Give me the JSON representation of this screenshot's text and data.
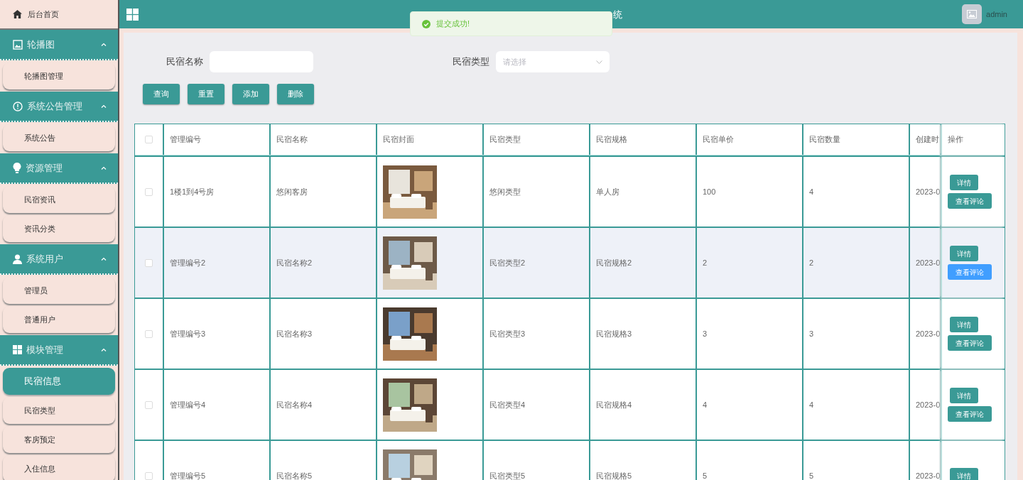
{
  "header": {
    "title": "统",
    "user": "admin"
  },
  "toast": {
    "message": "提交成功!"
  },
  "sidebar": {
    "home": "后台首页",
    "groups": [
      {
        "title": "轮播图",
        "expanded": true,
        "items": [
          {
            "label": "轮播图管理",
            "selected": false
          }
        ]
      },
      {
        "title": "系统公告管理",
        "expanded": true,
        "items": [
          {
            "label": "系统公告",
            "selected": false
          }
        ]
      },
      {
        "title": "资源管理",
        "expanded": true,
        "items": [
          {
            "label": "民宿资讯",
            "selected": false
          },
          {
            "label": "资讯分类",
            "selected": false
          }
        ]
      },
      {
        "title": "系统用户",
        "expanded": true,
        "items": [
          {
            "label": "管理员",
            "selected": false
          },
          {
            "label": "普通用户",
            "selected": false
          }
        ]
      },
      {
        "title": "模块管理",
        "expanded": true,
        "items": [
          {
            "label": "民宿信息",
            "selected": true
          },
          {
            "label": "民宿类型",
            "selected": false
          },
          {
            "label": "客房预定",
            "selected": false
          },
          {
            "label": "入住信息",
            "selected": false
          }
        ]
      }
    ]
  },
  "search": {
    "fields": [
      {
        "kind": "text",
        "label": "民宿名称"
      },
      {
        "kind": "select",
        "label": "民宿类型",
        "placeholder": "请选择"
      }
    ],
    "buttons": [
      "查询",
      "重置",
      "添加",
      "删除"
    ]
  },
  "table": {
    "all_checked": false,
    "columns": [
      "管理编号",
      "民宿名称",
      "民宿封面",
      "民宿类型",
      "民宿规格",
      "民宿单价",
      "民宿数量",
      "创建时",
      "操作"
    ],
    "rows": [
      {
        "checked": false,
        "hovered": false,
        "cells": [
          "1楼1到4号房",
          "悠闲客房",
          {
            "kind": "picture"
          },
          "悠闲类型",
          "单人房",
          "100",
          "4",
          "2023-0"
        ],
        "actions": [
          {
            "label": "详情",
            "hovered": false
          },
          {
            "label": "查看评论",
            "hovered": false
          }
        ]
      },
      {
        "checked": false,
        "hovered": true,
        "cells": [
          "管理编号2",
          "民宿名称2",
          {
            "kind": "picture"
          },
          "民宿类型2",
          "民宿规格2",
          "2",
          "2",
          "2023-0"
        ],
        "actions": [
          {
            "label": "详情",
            "hovered": false
          },
          {
            "label": "查看评论",
            "hovered": true
          }
        ]
      },
      {
        "checked": false,
        "hovered": false,
        "cells": [
          "管理编号3",
          "民宿名称3",
          {
            "kind": "picture"
          },
          "民宿类型3",
          "民宿规格3",
          "3",
          "3",
          "2023-0"
        ],
        "actions": [
          {
            "label": "详情",
            "hovered": false
          },
          {
            "label": "查看评论",
            "hovered": false
          }
        ]
      },
      {
        "checked": false,
        "hovered": false,
        "cells": [
          "管理编号4",
          "民宿名称4",
          {
            "kind": "picture"
          },
          "民宿类型4",
          "民宿规格4",
          "4",
          "4",
          "2023-0"
        ],
        "actions": [
          {
            "label": "详情",
            "hovered": false
          },
          {
            "label": "查看评论",
            "hovered": false
          }
        ]
      },
      {
        "checked": false,
        "hovered": false,
        "cells": [
          "管理编号5",
          "民宿名称5",
          {
            "kind": "picture"
          },
          "民宿类型5",
          "民宿规格5",
          "5",
          "5",
          "2023-0"
        ],
        "actions": [
          {
            "label": "详情",
            "hovered": false
          }
        ]
      }
    ]
  }
}
